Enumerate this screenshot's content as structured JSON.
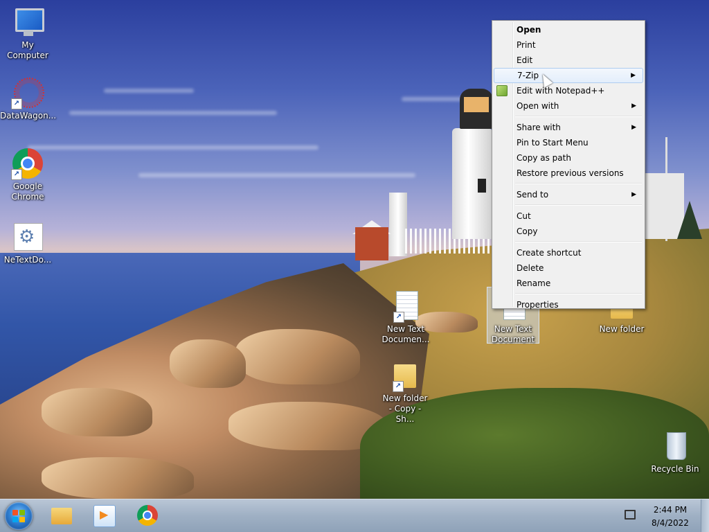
{
  "desktop": {
    "icons": [
      {
        "label": "My Computer",
        "glyph": "computer-icon",
        "shortcut": false
      },
      {
        "label": "DataWagon...",
        "glyph": "datawagon-icon",
        "shortcut": true
      },
      {
        "label": "Google Chrome",
        "glyph": "chrome-icon",
        "shortcut": true
      },
      {
        "label": "NeTextDo...",
        "glyph": "settings-document-icon",
        "shortcut": false
      },
      {
        "label": "New Text Documen...",
        "glyph": "text-document-icon",
        "shortcut": true
      },
      {
        "label": "New Text Document",
        "glyph": "text-document-icon",
        "shortcut": false,
        "selected": true
      },
      {
        "label": "New folder",
        "glyph": "folder-icon",
        "shortcut": false
      },
      {
        "label": "New folder - Copy - Sh...",
        "glyph": "folder-icon",
        "shortcut": true
      },
      {
        "label": "Recycle Bin",
        "glyph": "recycle-bin-icon",
        "shortcut": false
      }
    ]
  },
  "context_menu": {
    "items": [
      {
        "label": "Open",
        "bold": true
      },
      {
        "label": "Print"
      },
      {
        "label": "Edit"
      },
      {
        "label": "7-Zip",
        "submenu": true,
        "hovered": true
      },
      {
        "label": "Edit with Notepad++",
        "icon": "notepad-plus-plus-icon"
      },
      {
        "label": "Open with",
        "submenu": true
      },
      {
        "label": "Share with",
        "submenu": true
      },
      {
        "label": "Pin to Start Menu"
      },
      {
        "label": "Copy as path"
      },
      {
        "label": "Restore previous versions"
      },
      {
        "label": "Send to",
        "submenu": true
      },
      {
        "label": "Cut"
      },
      {
        "label": "Copy"
      },
      {
        "label": "Create shortcut"
      },
      {
        "label": "Delete"
      },
      {
        "label": "Rename"
      },
      {
        "label": "Properties"
      }
    ],
    "submenu_arrow": "▶"
  },
  "taskbar": {
    "pinned": [
      "windows-explorer-icon",
      "media-player-icon",
      "chrome-icon"
    ],
    "tray_icon": "network-icon",
    "time": "2:44 PM",
    "date": "8/4/2022"
  },
  "colors": {
    "taskbar": "#9fb0c4",
    "menu_background": "#f0f0f0",
    "menu_hover_border": "#aeccf0",
    "selection": "#c8d7eb"
  }
}
